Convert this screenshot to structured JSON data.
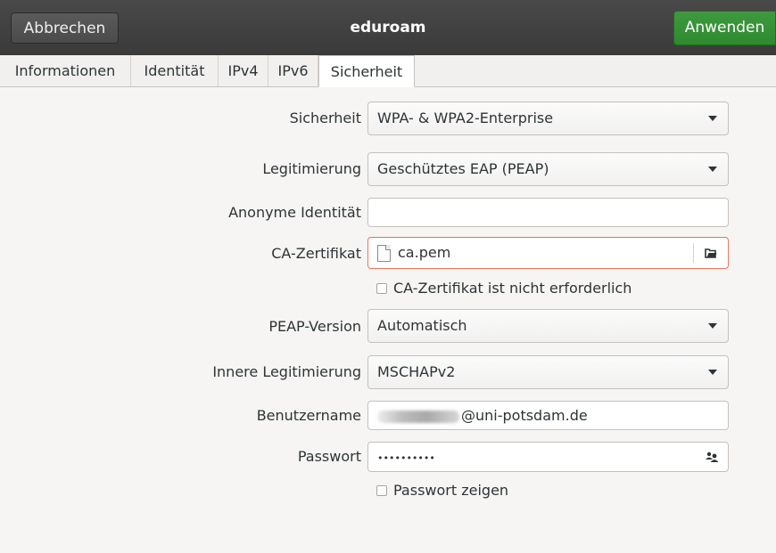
{
  "header": {
    "cancel_label": "Abbrechen",
    "title": "eduroam",
    "apply_label": "Anwenden",
    "apply_color": "#33903a"
  },
  "tabs": [
    {
      "label": "Informationen"
    },
    {
      "label": "Identität"
    },
    {
      "label": "IPv4"
    },
    {
      "label": "IPv6"
    },
    {
      "label": "Sicherheit",
      "active": true
    }
  ],
  "form": {
    "security": {
      "label": "Sicherheit",
      "value": "WPA- & WPA2-Enterprise"
    },
    "auth": {
      "label": "Legitimierung",
      "value": "Geschütztes EAP (PEAP)"
    },
    "anon_identity": {
      "label": "Anonyme Identität",
      "value": ""
    },
    "ca_cert": {
      "label": "CA-Zertifikat",
      "value": "ca.pem",
      "icon": "file-icon"
    },
    "ca_not_required": {
      "label": "CA-Zertifikat ist nicht erforderlich",
      "checked": false
    },
    "peap_version": {
      "label": "PEAP-Version",
      "value": "Automatisch"
    },
    "inner_auth": {
      "label": "Innere Legitimierung",
      "value": "MSCHAPv2"
    },
    "username": {
      "label": "Benutzername",
      "value_visible": "@uni-potsdam.de",
      "redacted": true
    },
    "password": {
      "label": "Passwort",
      "value": "••••••••••",
      "icon": "user-pair-icon"
    },
    "show_password": {
      "label": "Passwort zeigen",
      "checked": false
    }
  }
}
